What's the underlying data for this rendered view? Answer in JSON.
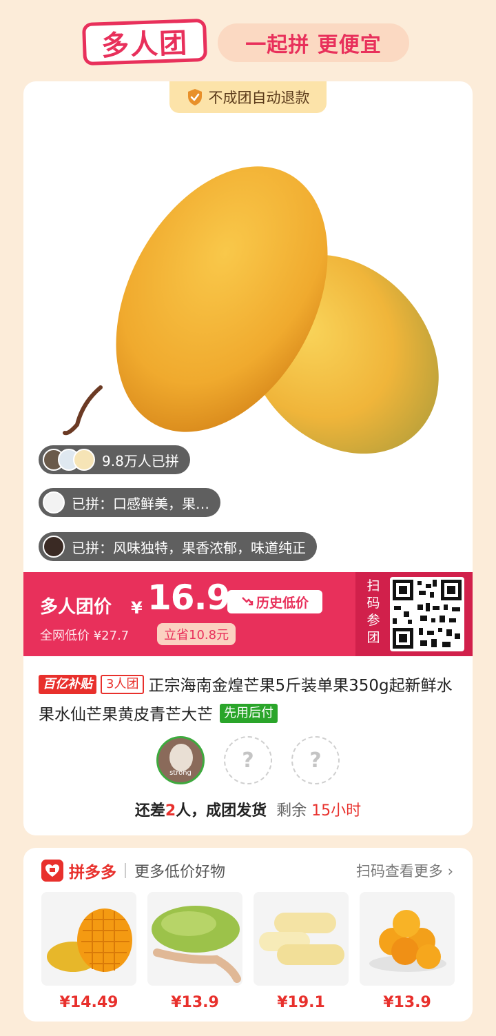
{
  "banner": {
    "logo": "多人团",
    "slogan": "一起拼 更便宜"
  },
  "refund_badge": "不成团自动退款",
  "bubbles": [
    {
      "text": "9.8万人已拼"
    },
    {
      "text": "已拼：口感鲜美，果…"
    },
    {
      "text": "已拼：风味独特，果香浓郁，味道纯正"
    }
  ],
  "price": {
    "label": "多人团价",
    "currency": "¥",
    "value": "16.9",
    "history_tag": "历史低价",
    "net_low": "全网低价 ¥27.7",
    "save": "立省10.8元",
    "scan_label": "扫码参团"
  },
  "product": {
    "tag_subsidy": "百亿补贴",
    "tag_group": "3人团",
    "title": "正宗海南金煌芒果5斤装单果350g起新鲜水果水仙芒果黄皮青芒大芒",
    "tag_pay": "先用后付"
  },
  "group": {
    "member_name": "strong",
    "empty_slot": "?",
    "status_prefix": "还差",
    "missing_count": "2",
    "status_suffix": "人，成团发货",
    "remaining_label": "剩余",
    "remaining_time": "15小时"
  },
  "recommend": {
    "brand": "拼多多",
    "subtitle": "更多低价好物",
    "scan_more": "扫码查看更多",
    "items": [
      {
        "price": "¥14.49"
      },
      {
        "price": "¥13.9"
      },
      {
        "price": "¥19.1"
      },
      {
        "price": "¥13.9"
      }
    ]
  },
  "colors": {
    "accent": "#e8305b",
    "background": "#fcecd9",
    "mango": "#f2b234",
    "green_tag": "#2aa52a"
  }
}
